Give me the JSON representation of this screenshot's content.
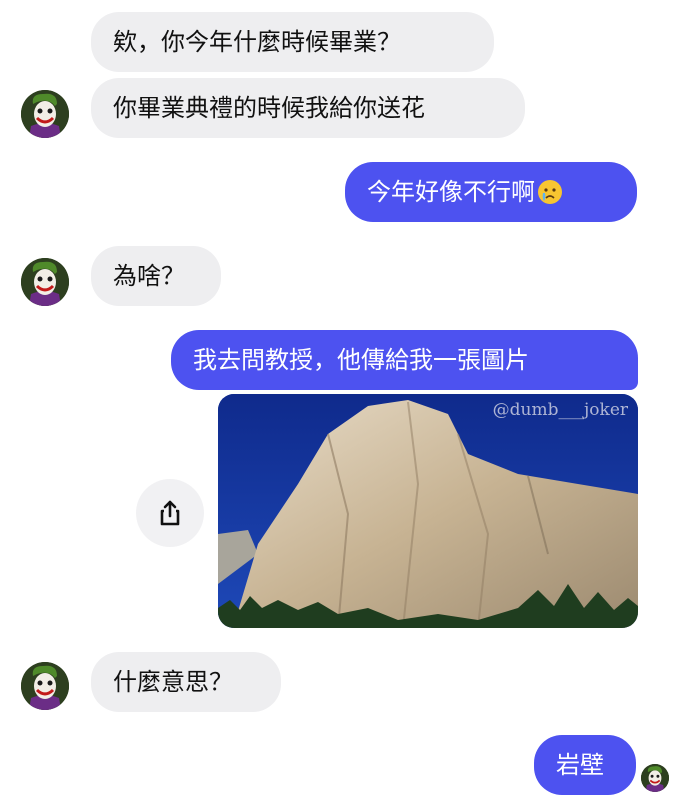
{
  "messages": {
    "m1": "欸，你今年什麼時候畢業？",
    "m2": "你畢業典禮的時候我給你送花",
    "m3": "今年好像不行啊",
    "m4": "為啥？",
    "m5": "我去問教授，他傳給我一張圖片",
    "m6": "什麼意思？",
    "m7": "岩壁"
  },
  "photo": {
    "watermark": "@dumb___joker",
    "subject": "granite cliff under blue sky"
  },
  "icons": {
    "emoji": "crying-face-emoji",
    "share": "share-icon",
    "avatar": "joker-avatar"
  },
  "colors": {
    "outgoing_bubble": "#4d52f0",
    "incoming_bubble": "#eeeef0",
    "sky": "#13339b"
  }
}
